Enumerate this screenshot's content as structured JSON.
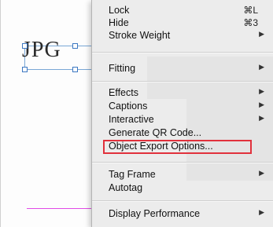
{
  "document": {
    "frame_text": "JPG"
  },
  "context_menu": {
    "items": [
      {
        "label": "Lock",
        "shortcut": "⌘L"
      },
      {
        "label": "Hide",
        "shortcut": "⌘3"
      },
      {
        "label": "Stroke Weight",
        "submenu_arrow": "▶"
      },
      {
        "label": "Fitting",
        "submenu_arrow": "▶"
      },
      {
        "label": "Effects",
        "submenu_arrow": "▶"
      },
      {
        "label": "Captions",
        "submenu_arrow": "▶"
      },
      {
        "label": "Interactive",
        "submenu_arrow": "▶"
      },
      {
        "label": "Generate QR Code..."
      },
      {
        "label": "Object Export Options..."
      },
      {
        "label": "Tag Frame",
        "submenu_arrow": "▶"
      },
      {
        "label": "Autotag"
      },
      {
        "label": "Display Performance",
        "submenu_arrow": "▶"
      }
    ]
  },
  "colors": {
    "menu_background": "#ececec",
    "highlight_outline": "#e1313c",
    "selection_blue": "#3d78c2",
    "guide_magenta": "#e14ae6"
  }
}
